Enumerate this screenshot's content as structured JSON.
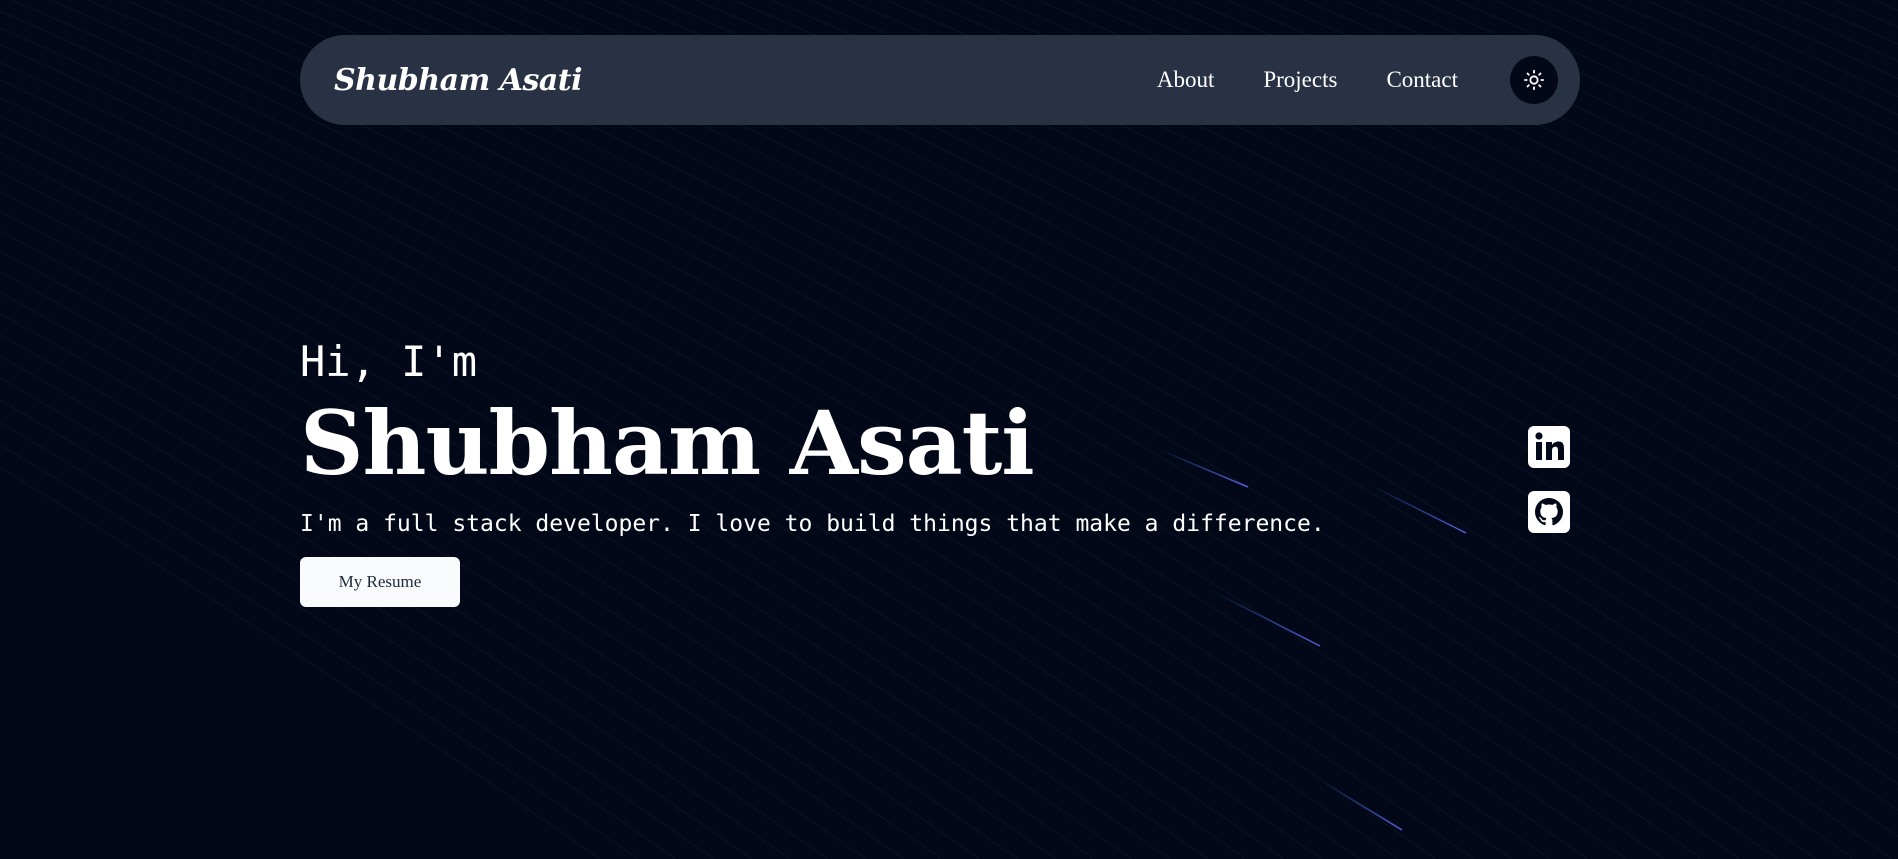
{
  "header": {
    "brand": "Shubham Asati",
    "nav": [
      {
        "label": "About"
      },
      {
        "label": "Projects"
      },
      {
        "label": "Contact"
      }
    ],
    "theme_toggle_icon": "sun-icon"
  },
  "hero": {
    "greeting": "Hi, I'm",
    "name": "Shubham Asati",
    "tagline": "I'm a full stack developer. I love to build things that make a difference.",
    "resume_label": "My Resume"
  },
  "socials": [
    {
      "icon": "linkedin-icon"
    },
    {
      "icon": "github-icon"
    }
  ],
  "colors": {
    "background": "#020817",
    "navbar": "#283244",
    "text": "#ffffff",
    "button_bg": "#f8fafc",
    "button_text": "#1e293b",
    "meteor": "#3b82f6"
  }
}
